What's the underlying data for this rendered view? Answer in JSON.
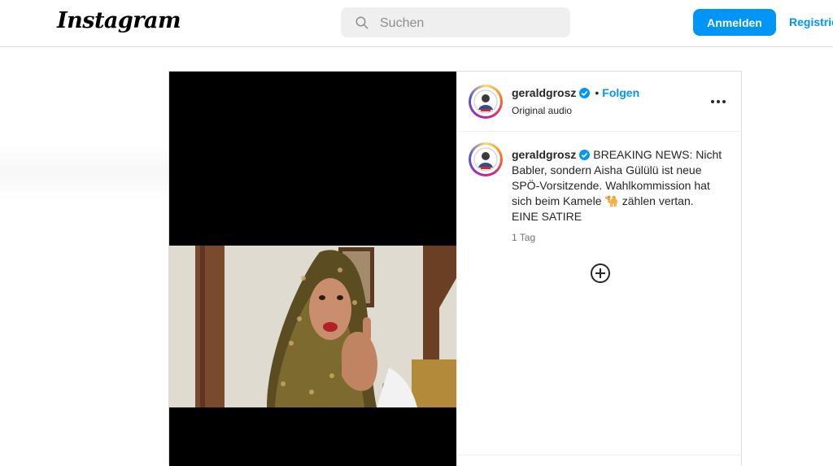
{
  "topbar": {
    "logo": "Instagram",
    "search": {
      "placeholder": "Suchen",
      "icon": "search-icon"
    },
    "login_label": "Anmelden",
    "register_label": "Registrieren"
  },
  "post": {
    "header": {
      "username": "geraldgrosz",
      "separator": "•",
      "follow_label": "Folgen",
      "audio": "Original audio",
      "more_icon": "more-icon"
    },
    "caption": {
      "username": "geraldgrosz",
      "text": "BREAKING NEWS: Nicht Babler, sondern Aisha Gülülü ist neue SPÖ-Vorsitzende. Wahlkommission hat sich beim Kamele 🐪 zählen vertan. EINE SATIRE",
      "time": "1 Tag"
    },
    "add_icon": "add-icon"
  },
  "colors": {
    "accent": "#0095f6",
    "border": "#dbdbdb",
    "text": "#262626",
    "muted": "#737373"
  }
}
